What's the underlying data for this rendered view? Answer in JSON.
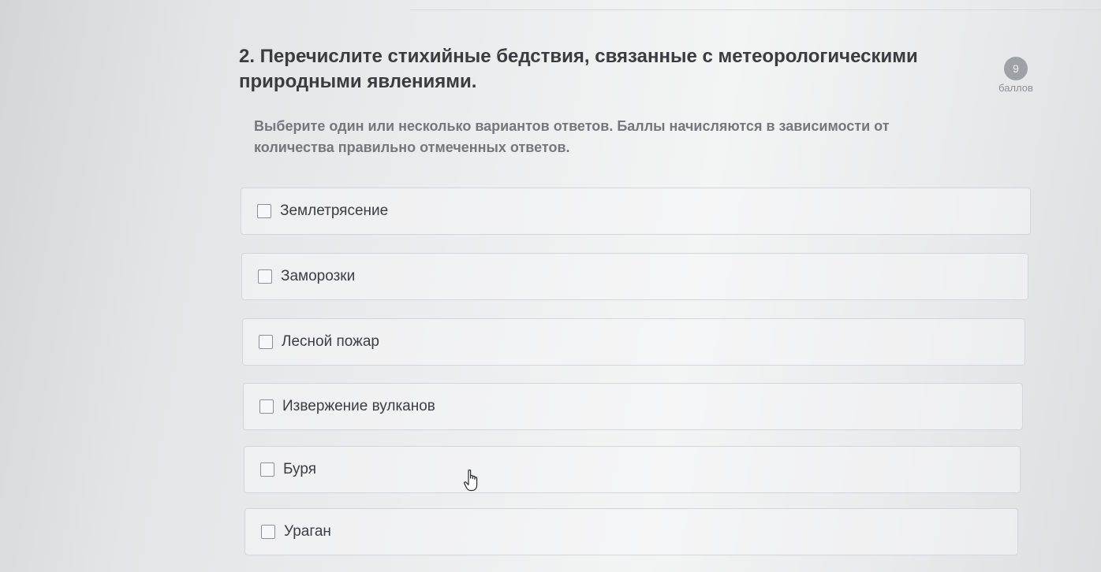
{
  "question": {
    "title": "2. Перечислите стихийные бедствия, связанные с метеорологическими природными явлениями.",
    "points_value": "9",
    "points_label": "баллов",
    "instruction": "Выберите один или несколько вариантов ответов. Баллы начисляются в зависимости от количества правильно отмеченных ответов."
  },
  "options": [
    {
      "label": "Землетрясение",
      "checked": false
    },
    {
      "label": "Заморозки",
      "checked": false
    },
    {
      "label": "Лесной пожар",
      "checked": false
    },
    {
      "label": "Извержение вулканов",
      "checked": false
    },
    {
      "label": "Буря",
      "checked": false
    },
    {
      "label": "Ураган",
      "checked": false
    }
  ],
  "colors": {
    "badge": "#9ea2a7",
    "title_text": "#3a3c40",
    "instruction_text": "#74777b",
    "option_border": "#d3d6d8"
  },
  "icons": {
    "cursor": "hand-pointer-icon"
  }
}
